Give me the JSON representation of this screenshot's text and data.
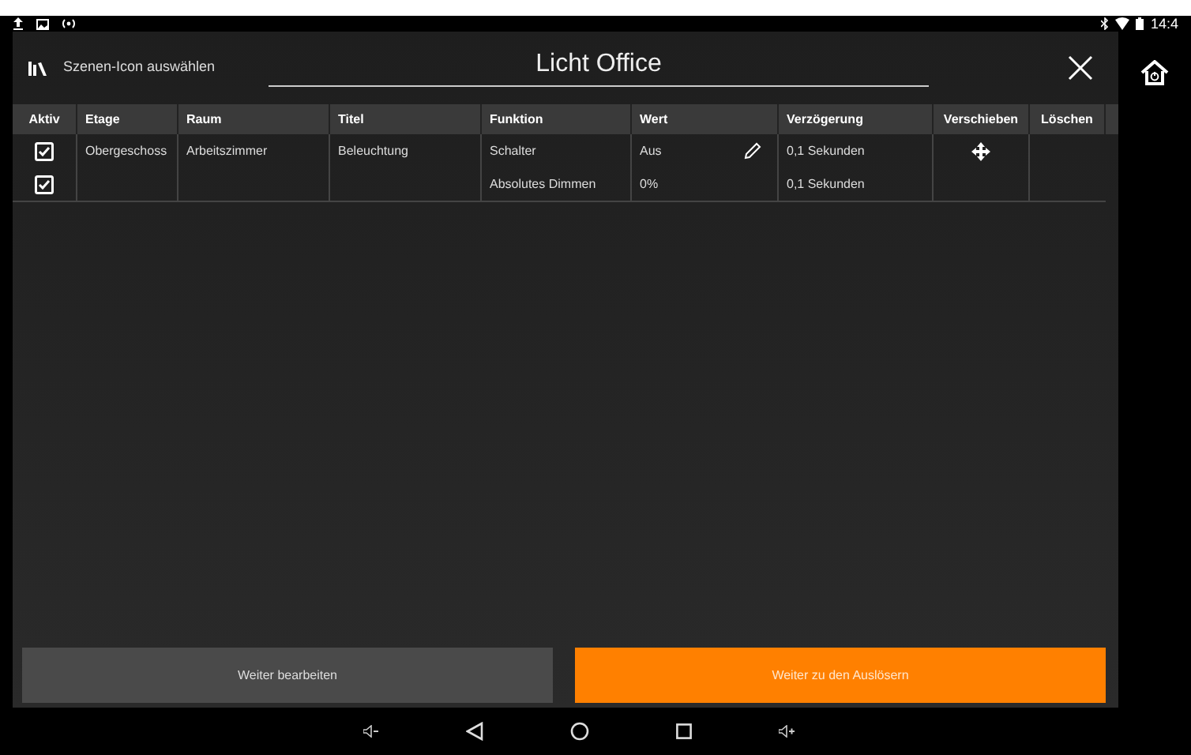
{
  "status_bar": {
    "time": "14:4"
  },
  "header": {
    "icon_label": "Szenen-Icon auswählen",
    "title": "Licht Office"
  },
  "table": {
    "columns": [
      "Aktiv",
      "Etage",
      "Raum",
      "Titel",
      "Funktion",
      "Wert",
      "Verzögerung",
      "Verschieben",
      "Löschen"
    ],
    "rows": [
      {
        "checked": true,
        "etage": "Obergeschoss",
        "raum": "Arbeitszimmer",
        "titel": "Beleuchtung",
        "funktion": "Schalter",
        "wert": "Aus",
        "editable": true,
        "verzoegerung": "0,1 Sekunden",
        "movable": true
      },
      {
        "checked": true,
        "etage": "",
        "raum": "",
        "titel": "",
        "funktion": "Absolutes Dimmen",
        "wert": "0%",
        "editable": false,
        "verzoegerung": "0,1 Sekunden",
        "movable": false
      }
    ]
  },
  "buttons": [
    {
      "label": "Weiter bearbeiten",
      "kind": "secondary"
    },
    {
      "label": "Weiter zu den Auslösern",
      "kind": "primary"
    }
  ]
}
